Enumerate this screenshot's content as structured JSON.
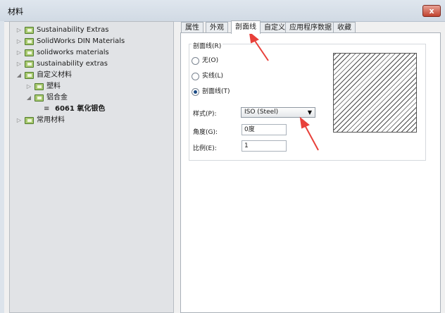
{
  "window": {
    "title": "材料",
    "close_label": "x"
  },
  "tree": {
    "items": [
      {
        "label": "Sustainability Extras",
        "expander": "▷"
      },
      {
        "label": "SolidWorks DIN Materials",
        "expander": "▷"
      },
      {
        "label": "solidworks materials",
        "expander": "▷"
      },
      {
        "label": "sustainability extras",
        "expander": "▷"
      },
      {
        "label": "自定义材料",
        "expander": "◢"
      },
      {
        "label": "塑料",
        "expander": "▷"
      },
      {
        "label": "铝合金",
        "expander": "◢"
      },
      {
        "label": "6061 氧化银色",
        "icon": "≡"
      },
      {
        "label": "常用材料",
        "expander": "▷"
      }
    ]
  },
  "tabs": [
    {
      "label": "属性"
    },
    {
      "label": "外观"
    },
    {
      "label": "剖面线"
    },
    {
      "label": "自定义"
    },
    {
      "label": "应用程序数据"
    },
    {
      "label": "收藏"
    }
  ],
  "active_tab": "剖面线",
  "hatch_group": {
    "label": "剖面线(R)",
    "options": [
      {
        "label": "无(O)",
        "selected": false
      },
      {
        "label": "实线(L)",
        "selected": false
      },
      {
        "label": "剖面线(T)",
        "selected": true
      }
    ],
    "style_label": "样式(P):",
    "style_value": "ISO (Steel)",
    "angle_label": "角度(G):",
    "angle_value": "0度",
    "scale_label": "比例(E):",
    "scale_value": "1"
  },
  "colors": {
    "accent_arrow": "#e8403a",
    "folder": "#a8c96f"
  }
}
